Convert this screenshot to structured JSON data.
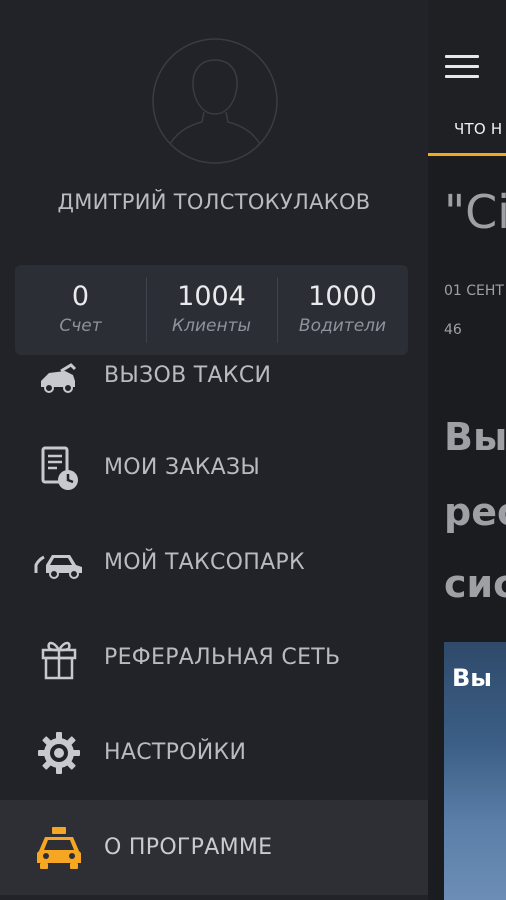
{
  "content": {
    "tab_label": "ЧТО Н",
    "headline": "\"Сі",
    "date": "01 СЕНТ",
    "views": "46",
    "lead_lines": [
      "Вы",
      "рес",
      "сис"
    ],
    "media_title": "Вы"
  },
  "drawer": {
    "user_name": "ДМИТРИЙ ТОЛСТОКУЛАКОВ",
    "stats": [
      {
        "value": "0",
        "label": "Счет"
      },
      {
        "value": "1004",
        "label": "Клиенты"
      },
      {
        "value": "1000",
        "label": "Водители"
      }
    ],
    "menu": [
      {
        "label": "ВЫЗОВ ТАКСИ",
        "icon": "taxi-call-icon"
      },
      {
        "label": "МОИ ЗАКАЗЫ",
        "icon": "orders-icon"
      },
      {
        "label": "МОЙ ТАКСОПАРК",
        "icon": "car-fleet-icon"
      },
      {
        "label": "РЕФЕРАЛЬНАЯ СЕТЬ",
        "icon": "gift-icon"
      },
      {
        "label": "НАСТРОЙКИ",
        "icon": "gear-icon"
      },
      {
        "label": "О ПРОГРАММЕ",
        "icon": "taxi-icon"
      }
    ]
  },
  "colors": {
    "accent": "#f5a623",
    "drawer_bg": "#222328",
    "stats_bg": "#2c2e35",
    "active_item_bg": "#2d2f35"
  }
}
